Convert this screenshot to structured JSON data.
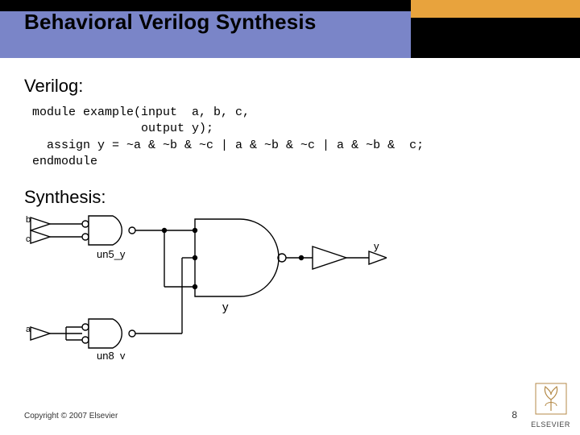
{
  "header": {
    "title": "Behavioral Verilog Synthesis"
  },
  "sections": {
    "verilog_label": "Verilog:",
    "synthesis_label": "Synthesis:"
  },
  "code": {
    "l1": "module example(input  a, b, c,",
    "l2": "               output y);",
    "l3": "  assign y = ~a & ~b & ~c | a & ~b & ~c | a & ~b &  c;",
    "l4": "endmodule"
  },
  "diagram": {
    "inputs": {
      "a": "a",
      "b": "b",
      "c": "c"
    },
    "output": "y",
    "ynode": "y",
    "gates": {
      "un5": "un5_y",
      "un8": "un8_y"
    }
  },
  "footer": {
    "copyright": "Copyright © 2007 Elsevier",
    "page": "8",
    "publisher": "ELSEVIER"
  }
}
